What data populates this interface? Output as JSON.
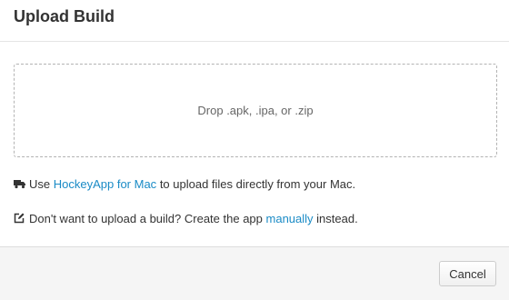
{
  "modal": {
    "title": "Upload Build"
  },
  "dropzone": {
    "text": "Drop .apk, .ipa, or .zip"
  },
  "hint_mac": {
    "icon": "truck-icon",
    "prefix": "Use",
    "link": "HockeyApp for Mac",
    "suffix": "to upload files directly from your Mac."
  },
  "hint_manual": {
    "icon": "edit-icon",
    "prefix": "Don't want to upload a build? Create the app",
    "link": "manually",
    "suffix": "instead."
  },
  "footer": {
    "cancel_label": "Cancel"
  },
  "colors": {
    "link": "#1a8bc6",
    "text": "#333333",
    "footer_bg": "#f5f5f5"
  }
}
